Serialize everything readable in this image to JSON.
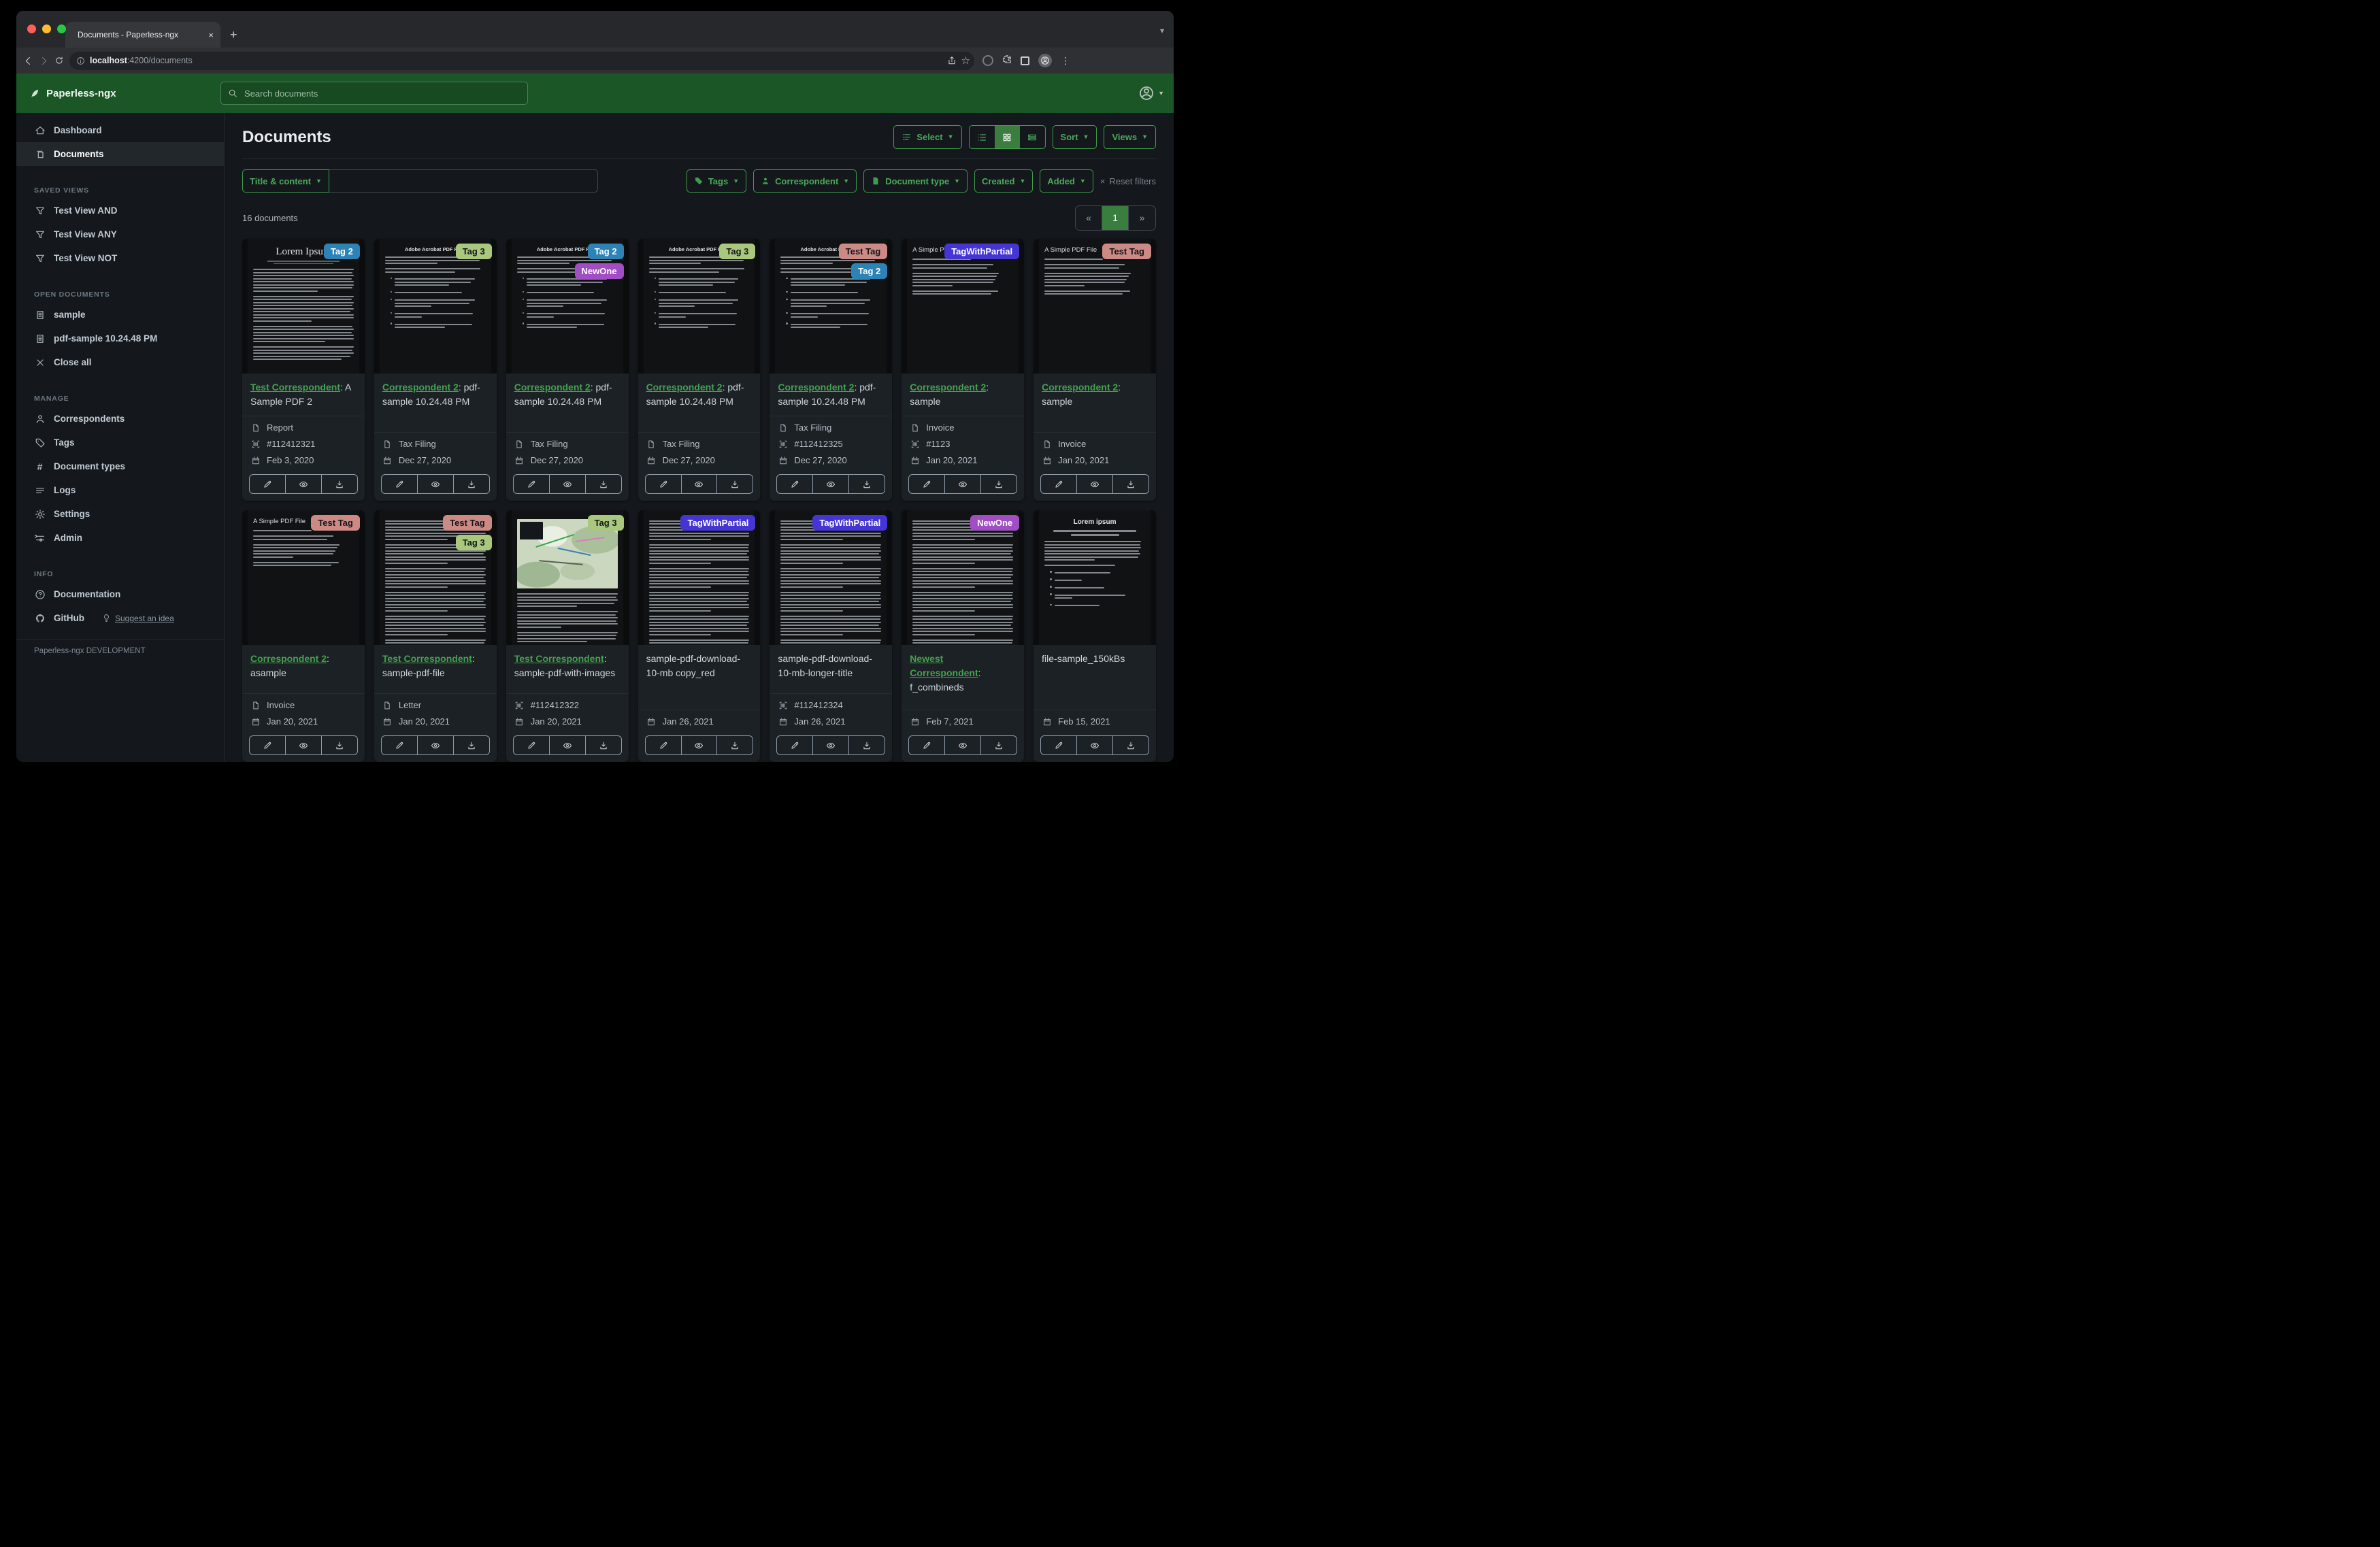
{
  "browser": {
    "tab_title": "Documents - Paperless-ngx",
    "tab_close": "×",
    "new_tab": "+",
    "url_host": "localhost",
    "url_path": ":4200/documents",
    "toolbar_icons": [
      "back-icon",
      "forward-icon",
      "reload-icon",
      "info-icon",
      "share-icon",
      "star-icon",
      "password-manager-icon",
      "extensions-icon",
      "window-icon",
      "profile-icon",
      "menu-dots-icon"
    ]
  },
  "navbar": {
    "brand": "Paperless-ngx",
    "search_placeholder": "Search documents"
  },
  "sidebar": {
    "primary": [
      {
        "icon": "home",
        "label": "Dashboard",
        "active": false
      },
      {
        "icon": "documents",
        "label": "Documents",
        "active": true
      }
    ],
    "sections": [
      {
        "title": "SAVED VIEWS",
        "items": [
          {
            "icon": "filter",
            "label": "Test View AND"
          },
          {
            "icon": "filter",
            "label": "Test View ANY"
          },
          {
            "icon": "filter",
            "label": "Test View NOT"
          }
        ]
      },
      {
        "title": "OPEN DOCUMENTS",
        "items": [
          {
            "icon": "filetext",
            "label": "sample"
          },
          {
            "icon": "filetext",
            "label": "pdf-sample 10.24.48 PM"
          },
          {
            "icon": "close",
            "label": "Close all"
          }
        ]
      },
      {
        "title": "MANAGE",
        "items": [
          {
            "icon": "person",
            "label": "Correspondents"
          },
          {
            "icon": "tag",
            "label": "Tags"
          },
          {
            "icon": "hash",
            "label": "Document types"
          },
          {
            "icon": "lines",
            "label": "Logs"
          },
          {
            "icon": "gear",
            "label": "Settings"
          },
          {
            "icon": "toggles",
            "label": "Admin"
          }
        ]
      },
      {
        "title": "INFO",
        "items": [
          {
            "icon": "question",
            "label": "Documentation"
          },
          {
            "icon": "github",
            "label": "GitHub",
            "extra": "Suggest an idea",
            "extra_icon": "lightbulb"
          }
        ]
      }
    ],
    "footer": "Paperless-ngx DEVELOPMENT"
  },
  "header": {
    "title": "Documents",
    "select_label": "Select",
    "sort_label": "Sort",
    "views_label": "Views",
    "view_modes": [
      "list-view-icon",
      "grid-view-icon",
      "detail-view-icon"
    ],
    "active_view": 1
  },
  "filters": {
    "field_label": "Title & content",
    "field_value": "",
    "buttons": [
      {
        "icon": "tagfill",
        "label": "Tags"
      },
      {
        "icon": "personfill",
        "label": "Correspondent"
      },
      {
        "icon": "docfill",
        "label": "Document type"
      },
      {
        "icon": "",
        "label": "Created"
      },
      {
        "icon": "",
        "label": "Added"
      }
    ],
    "reset_label": "Reset filters"
  },
  "status": {
    "count_text": "16 documents",
    "page_prev": "«",
    "page_current": "1",
    "page_next": "»"
  },
  "tags": {
    "Tag 2": {
      "bg": "#2d83b5",
      "fg": "#ffffff"
    },
    "Tag 3": {
      "bg": "#a9c87e",
      "fg": "#11161a"
    },
    "NewOne": {
      "bg": "#a14ec4",
      "fg": "#ffffff"
    },
    "Test Tag": {
      "bg": "#cd8a84",
      "fg": "#11161a"
    },
    "TagWithPartial": {
      "bg": "#4536d4",
      "fg": "#ffffff"
    }
  },
  "cards": [
    {
      "thumb": "lorem",
      "tags": [
        "Tag 2"
      ],
      "link": "Test Correspondent",
      "title": ": A Sample PDF 2",
      "doc_type": "Report",
      "asn": "#112412321",
      "date": "Feb 3, 2020"
    },
    {
      "thumb": "acrobat",
      "tags": [
        "Tag 3"
      ],
      "link": "Correspondent 2",
      "title": ": pdf-sample 10.24.48 PM",
      "doc_type": "Tax Filing",
      "date": "Dec 27, 2020"
    },
    {
      "thumb": "acrobat",
      "tags": [
        "Tag 2",
        "NewOne"
      ],
      "link": "Correspondent 2",
      "title": ": pdf-sample 10.24.48 PM",
      "doc_type": "Tax Filing",
      "date": "Dec 27, 2020"
    },
    {
      "thumb": "acrobat",
      "tags": [
        "Tag 3"
      ],
      "link": "Correspondent 2",
      "title": ": pdf-sample 10.24.48 PM",
      "doc_type": "Tax Filing",
      "date": "Dec 27, 2020"
    },
    {
      "thumb": "acrobat",
      "tags": [
        "Test Tag",
        "Tag 2"
      ],
      "link": "Correspondent 2",
      "title": ": pdf-sample 10.24.48 PM",
      "doc_type": "Tax Filing",
      "asn": "#112412325",
      "date": "Dec 27, 2020"
    },
    {
      "thumb": "simple",
      "tags": [
        "TagWithPartial"
      ],
      "link": "Correspondent 2",
      "title": ": sample",
      "doc_type": "Invoice",
      "asn": "#1123",
      "date": "Jan 20, 2021"
    },
    {
      "thumb": "simple",
      "tags": [
        "Test Tag"
      ],
      "link": "Correspondent 2",
      "title": ": sample",
      "doc_type": "Invoice",
      "date": "Jan 20, 2021"
    },
    {
      "thumb": "simple",
      "tags": [
        "Test Tag"
      ],
      "link": "Correspondent 2",
      "title": ": asample",
      "doc_type": "Invoice",
      "date": "Jan 20, 2021"
    },
    {
      "thumb": "dense",
      "tags": [
        "Test Tag",
        "Tag 3"
      ],
      "link": "Test Correspondent",
      "title": ": sample-pdf-file",
      "doc_type": "Letter",
      "date": "Jan 20, 2021"
    },
    {
      "thumb": "map",
      "tags": [
        "Tag 3"
      ],
      "link": "Test Correspondent",
      "title": ": sample-pdf-with-images",
      "asn": "#112412322",
      "date": "Jan 20, 2021"
    },
    {
      "thumb": "dense",
      "tags": [
        "TagWithPartial"
      ],
      "title": "sample-pdf-download-10-mb copy_red",
      "date": "Jan 26, 2021"
    },
    {
      "thumb": "dense",
      "tags": [
        "TagWithPartial"
      ],
      "title": "sample-pdf-download-10-mb-longer-title",
      "asn": "#112412324",
      "date": "Jan 26, 2021"
    },
    {
      "thumb": "dense",
      "tags": [
        "NewOne"
      ],
      "link": "Newest Correspondent",
      "title": ": f_combineds",
      "date": "Feb 7, 2021"
    },
    {
      "thumb": "lorem2",
      "tags": [],
      "title": "file-sample_150kBs",
      "date": "Feb 15, 2021"
    }
  ],
  "card_action_icons": [
    "edit-pencil-icon",
    "preview-eye-icon",
    "download-icon"
  ]
}
